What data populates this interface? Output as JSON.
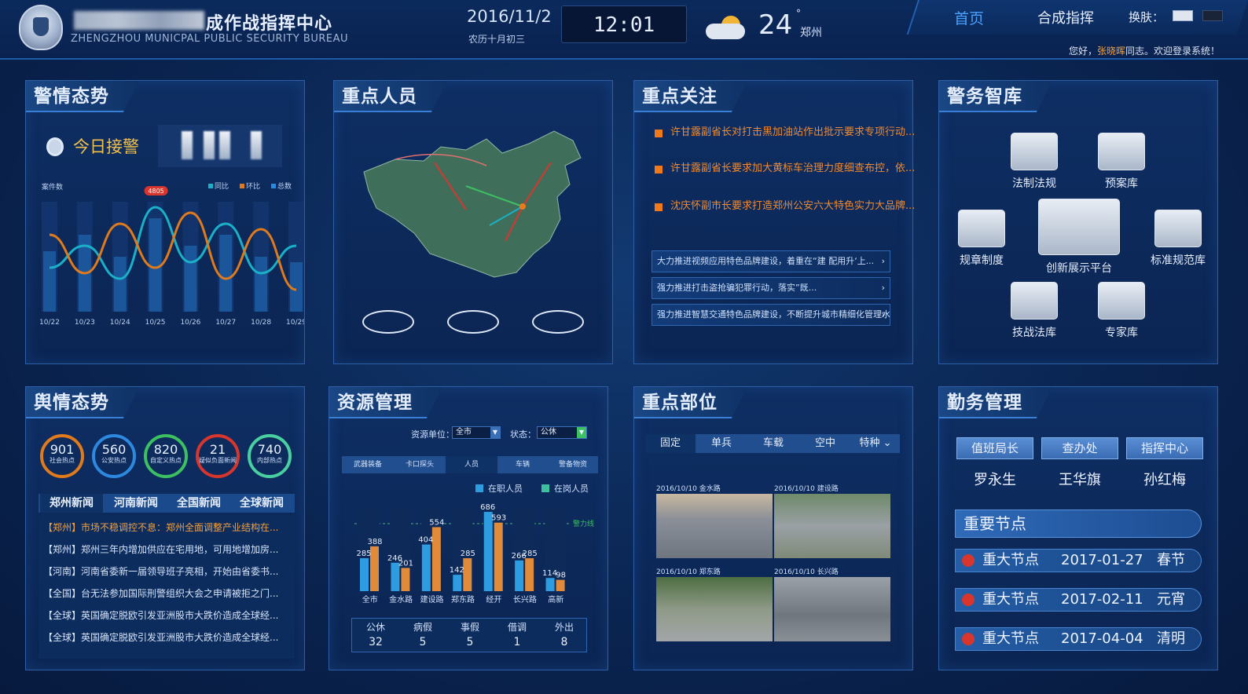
{
  "header": {
    "title_cn": "成作战指挥中心",
    "title_en": "ZHENGZHOU MUNICPAL PUBLIC SECURITY BUREAU",
    "date": "2016/11/2",
    "lunar": "农历十月初三",
    "time": "12:01",
    "temperature": "24",
    "degree": "°",
    "city": "郑州",
    "nav_home": "首页",
    "nav_command": "合成指挥",
    "nav_skin": "换肤：",
    "welcome_prefix": "您好，",
    "welcome_user": "张晓晖",
    "welcome_suffix": "同志。欢迎登录系统！"
  },
  "police_situation": {
    "title": "警情态势",
    "today_label": "今日接警",
    "chart_data": {
      "type": "line",
      "ylabel": "案件数",
      "peak_label": "4805",
      "categories": [
        "10/22",
        "10/23",
        "10/24",
        "10/25",
        "10/26",
        "10/27",
        "10/28",
        "10/29"
      ],
      "legend": [
        "同比",
        "环比",
        "总数"
      ],
      "colors": {
        "yoy": "#1ab0c8",
        "mom": "#e07a1a",
        "total": "#2d88e0"
      },
      "series": [
        {
          "name": "同比",
          "values": [
            40,
            60,
            30,
            95,
            45,
            80,
            35,
            60
          ]
        },
        {
          "name": "环比",
          "values": [
            70,
            35,
            80,
            40,
            90,
            30,
            75,
            20
          ]
        },
        {
          "name": "总数",
          "values": [
            55,
            70,
            50,
            85,
            60,
            70,
            50,
            45
          ]
        }
      ]
    }
  },
  "key_persons": {
    "title": "重点人员"
  },
  "key_focus": {
    "title": "重点关注",
    "items": [
      "许甘露副省长对打击黑加油站作出批示要求专项行动...",
      "许甘露副省长要求加大黄标车治理力度细查布控，依...",
      "沈庆怀副市长要求打造郑州公安六大特色实力大品牌..."
    ],
    "links": [
      "大力推进视频应用特色品牌建设，着重在“建 配用升‘上...",
      "强力推进打击盗抢骗犯罪行动，落实”既...",
      "强力推进智慧交通特色品牌建设，不断提升城市精细化管理水..."
    ]
  },
  "police_library": {
    "title": "警务智库",
    "items": [
      "法制法规",
      "预案库",
      "规章制度",
      "创新展示平台",
      "标准规范库",
      "技战法库",
      "专家库"
    ]
  },
  "public_opinion": {
    "title": "舆情态势",
    "circles": [
      {
        "value": "901",
        "label": "社会热点",
        "color": "#e07a1a"
      },
      {
        "value": "560",
        "label": "公安热点",
        "color": "#2d88e0"
      },
      {
        "value": "820",
        "label": "自定义热点",
        "color": "#3cc060"
      },
      {
        "value": "21",
        "label": "疑似负面新闻",
        "color": "#d8362c"
      },
      {
        "value": "740",
        "label": "内部热点",
        "color": "#4ad0a0"
      }
    ],
    "tabs": [
      "郑州新闻",
      "河南新闻",
      "全国新闻",
      "全球新闻"
    ],
    "news": [
      "【郑州】市场不稳调控不息：郑州全面调整产业结构在...",
      "【郑州】郑州三年内增加供应在宅用地，可用地增加房...",
      "【河南】河南省委新一届领导班子亮相，开始由省委书...",
      "【全国】台无法参加国际刑警组织大会之申请被拒之门...",
      "【全球】英国确定脱欧引发亚洲股市大跌价造成全球经...",
      "【全球】英国确定脱欧引发亚洲股市大跌价造成全球经..."
    ]
  },
  "resources": {
    "title": "资源管理",
    "filter_unit_label": "资源单位：",
    "filter_unit_value": "全市",
    "filter_status_label": "状态：",
    "filter_status_value": "公休",
    "tabs": [
      "武器装备",
      "卡口探头",
      "人员",
      "车辆",
      "警备物资"
    ],
    "chart_data": {
      "type": "bar",
      "legend": [
        "在职人员",
        "在岗人员"
      ],
      "warning_label": "警力线",
      "categories": [
        "全市",
        "金水路",
        "建设路",
        "郑东路",
        "经开",
        "长兴路",
        "高新"
      ],
      "series": [
        {
          "name": "在职人员",
          "values": [
            285,
            246,
            404,
            142,
            686,
            266,
            114
          ]
        },
        {
          "name": "在岗人员",
          "values": [
            388,
            201,
            554,
            285,
            593,
            285,
            98
          ]
        }
      ],
      "colors": {
        "a": "#2d9ce0",
        "b": "#e08a3a"
      }
    },
    "table": {
      "headers": [
        "公休",
        "病假",
        "事假",
        "借调",
        "外出"
      ],
      "values": [
        "32",
        "5",
        "5",
        "1",
        "8"
      ]
    }
  },
  "key_locations": {
    "title": "重点部位",
    "tabs": [
      "固定",
      "单兵",
      "车载",
      "空中",
      "特种 ⌄"
    ],
    "cams": [
      {
        "date": "2016/10/10",
        "place": "金水路"
      },
      {
        "date": "2016/10/10",
        "place": "建设路"
      },
      {
        "date": "2016/10/10",
        "place": "郑东路"
      },
      {
        "date": "2016/10/10",
        "place": "长兴路"
      }
    ]
  },
  "duty": {
    "title": "勤务管理",
    "roles": [
      "值班局长",
      "查办处",
      "指挥中心"
    ],
    "names": [
      "罗永生",
      "王华旗",
      "孙红梅"
    ],
    "nodes_title": "重要节点",
    "nodes": [
      {
        "label": "重大节点",
        "date": "2017-01-27",
        "festival": "春节"
      },
      {
        "label": "重大节点",
        "date": "2017-02-11",
        "festival": "元宵"
      },
      {
        "label": "重大节点",
        "date": "2017-04-04",
        "festival": "清明"
      }
    ]
  }
}
